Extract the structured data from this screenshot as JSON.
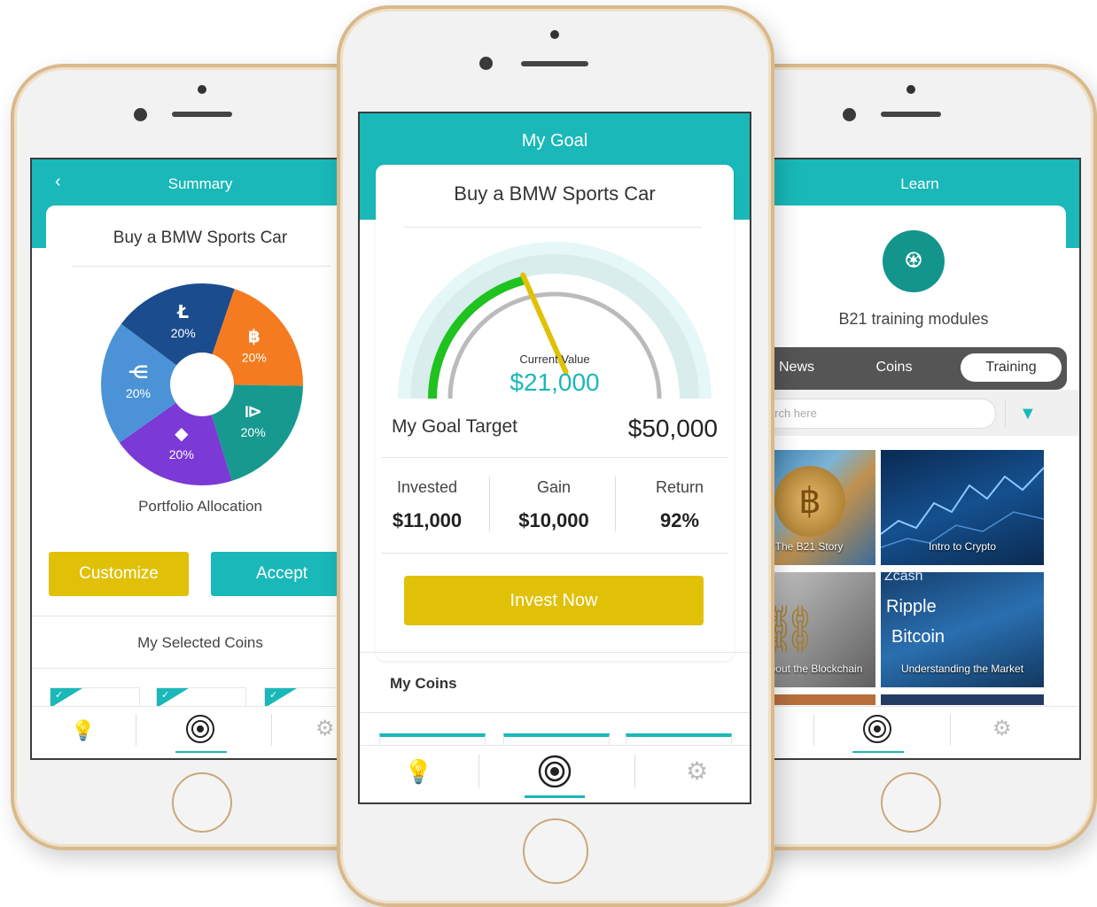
{
  "left": {
    "header_title": "Summary",
    "goal_title": "Buy a BMW Sports Car",
    "slices": [
      {
        "symbol": "Ł",
        "label": "20%",
        "color": "#1b4d8e"
      },
      {
        "symbol": "฿",
        "label": "20%",
        "color": "#f47b1f"
      },
      {
        "symbol": "⧐",
        "label": "20%",
        "color": "#17998f"
      },
      {
        "symbol": "◆",
        "label": "20%",
        "color": "#7b39d6"
      },
      {
        "symbol": "⋲",
        "label": "20%",
        "color": "#4b93d6"
      }
    ],
    "allocation_label": "Portfolio Allocation",
    "customize_label": "Customize",
    "accept_label": "Accept",
    "selected_coins_label": "My Selected Coins"
  },
  "center": {
    "header_title": "My Goal",
    "goal_title": "Buy a BMW Sports Car",
    "gauge": {
      "current_label": "Current Value",
      "current_value": "$21,000",
      "fraction": 0.42
    },
    "target_label": "My Goal Target",
    "target_value": "$50,000",
    "stats": [
      {
        "label": "Invested",
        "value": "$11,000"
      },
      {
        "label": "Gain",
        "value": "$10,000"
      },
      {
        "label": "Return",
        "value": "92%"
      }
    ],
    "invest_label": "Invest Now",
    "my_coins_label": "My Coins"
  },
  "right": {
    "header_title": "Learn",
    "module_title": "B21 training modules",
    "tabs": [
      {
        "label": "News"
      },
      {
        "label": "Coins"
      },
      {
        "label": "Training"
      }
    ],
    "active_tab": "Training",
    "search_placeholder": "Search here",
    "thumbs": [
      {
        "caption": "The B21 Story"
      },
      {
        "caption": "Intro to Crypto"
      },
      {
        "caption": "ll About the Blockchain"
      },
      {
        "caption": "Understanding the Market"
      }
    ],
    "thumb_text": {
      "zcash": "Zcash",
      "ripple": "Ripple",
      "bitcoin": "Bitcoin"
    }
  },
  "colors": {
    "teal": "#1ab8b8",
    "gold": "#e0c108",
    "gold_border": "#d9b98c"
  }
}
